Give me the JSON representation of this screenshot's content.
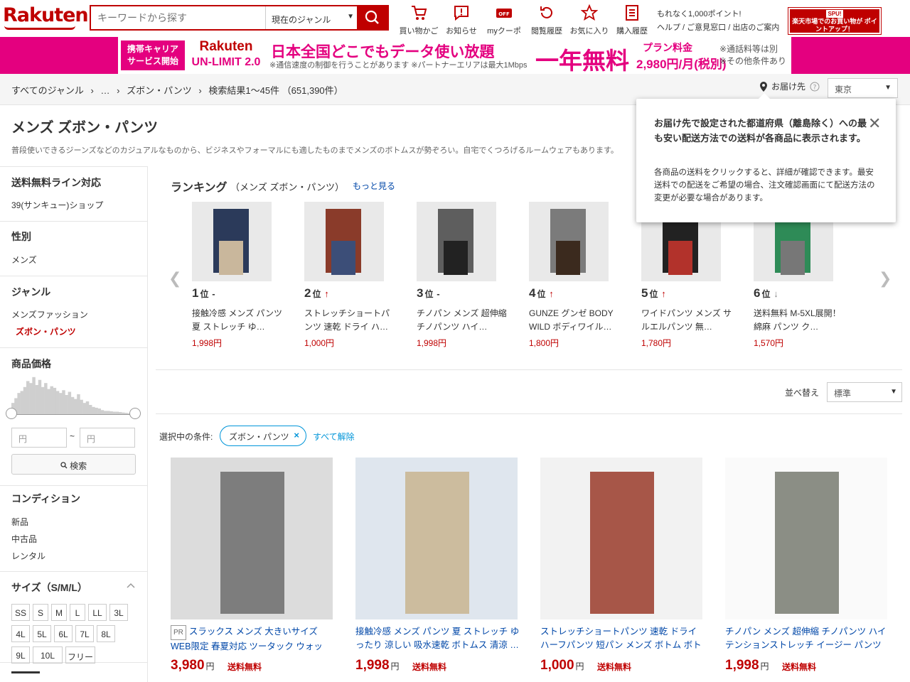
{
  "header": {
    "logo": "Rakuten",
    "search_placeholder": "キーワードから探す",
    "genre_select": "現在のジャンル",
    "icons": [
      {
        "label": "買い物かご",
        "icon": "cart-icon"
      },
      {
        "label": "お知らせ",
        "icon": "notice-icon"
      },
      {
        "label": "myクーポン",
        "icon": "coupon-icon"
      },
      {
        "label": "閲覧履歴",
        "icon": "history-icon"
      },
      {
        "label": "お気に入り",
        "icon": "star-icon"
      },
      {
        "label": "購入履歴",
        "icon": "receipt-icon"
      }
    ],
    "points_text": "もれなく1,000ポイント!",
    "help_links": "ヘルプ / ご意見窓口 / 出店のご案内",
    "spu_top": "SPU!",
    "spu_text": "楽天市場でのお買い物が ポイントアップ！"
  },
  "banner": {
    "tag_line1": "携帯キャリア",
    "tag_line2": "サービス開始",
    "brand": "Rakuten",
    "brand_sub": "UN-LIMIT 2.0",
    "main": "日本全国どこでもデータ使い放題",
    "sub": "※通信速度の制御を行うことがあります ※パートナーエリアは最大1Mbps",
    "free": "一年無料",
    "plan": "プラン料金",
    "price": "2,980円/月(税別)",
    "note1": "※通話料等は別",
    "note2": "※その他条件あり"
  },
  "breadcrumb": {
    "items": [
      "すべてのジャンル",
      "›",
      "…",
      "›",
      "ズボン・パンツ",
      "›"
    ],
    "result": "検索結果1〜45件 （651,390件）",
    "delivery_label": "お届け先",
    "delivery_value": "東京"
  },
  "page": {
    "title": "メンズ ズボン・パンツ",
    "description": "普段使いできるジーンズなどのカジュアルなものから、ビジネスやフォーマルにも適したものまでメンズのボトムスが勢ぞろい。自宅でくつろげるルームウェアもあります。"
  },
  "sidebar": {
    "shipping_title": "送料無料ライン対応",
    "shipping_item": "39(サンキュー)ショップ",
    "gender_title": "性別",
    "gender_item": "メンズ",
    "genre_title": "ジャンル",
    "genre_parent": "メンズファッション",
    "genre_current": "ズボン・パンツ",
    "price_title": "商品価格",
    "price_min_placeholder": "円",
    "price_sep": "~",
    "price_max_placeholder": "円",
    "search_button": "検索",
    "condition_title": "コンディション",
    "conditions": [
      "新品",
      "中古品",
      "レンタル"
    ],
    "size_title": "サイズ（S/M/L）",
    "sizes": [
      "SS",
      "S",
      "M",
      "L",
      "LL",
      "3L",
      "4L",
      "5L",
      "6L",
      "7L",
      "8L",
      "9L",
      "10L",
      "フリー"
    ],
    "histogram": [
      0.3,
      0.42,
      0.55,
      0.6,
      0.7,
      0.85,
      0.8,
      0.95,
      0.75,
      0.88,
      0.7,
      0.8,
      0.65,
      0.72,
      0.68,
      0.6,
      0.55,
      0.62,
      0.5,
      0.58,
      0.45,
      0.4,
      0.52,
      0.38,
      0.3,
      0.34,
      0.25,
      0.2,
      0.18,
      0.16,
      0.12,
      0.1,
      0.1,
      0.09,
      0.08,
      0.08,
      0.07,
      0.06,
      0.05,
      0.04,
      0.04,
      0.03
    ]
  },
  "ranking": {
    "title": "ランキング",
    "subtitle": "（メンズ ズボン・パンツ）",
    "more": "もっと見る",
    "items": [
      {
        "rank": "1",
        "unit": "位",
        "trend": "-",
        "name": "接触冷感 メンズ パンツ 夏 ストレッチ ゆ…",
        "price": "1,998円"
      },
      {
        "rank": "2",
        "unit": "位",
        "trend": "↑",
        "name": "ストレッチショートパンツ 速乾 ドライ ハ…",
        "price": "1,000円"
      },
      {
        "rank": "3",
        "unit": "位",
        "trend": "-",
        "name": "チノパン メンズ 超伸縮 チノパンツ ハイ…",
        "price": "1,998円"
      },
      {
        "rank": "4",
        "unit": "位",
        "trend": "↑",
        "name": "GUNZE グンゼ BODY WILD ボディワイル…",
        "price": "1,800円"
      },
      {
        "rank": "5",
        "unit": "位",
        "trend": "↑",
        "name": "ワイドパンツ メンズ サルエルパンツ 無…",
        "price": "1,780円"
      },
      {
        "rank": "6",
        "unit": "位",
        "trend": "↓",
        "name": "送料無料 M-5XL展開！綿麻 パンツ ク…",
        "price": "1,570円"
      }
    ]
  },
  "sort": {
    "label": "並べ替え",
    "value": "標準"
  },
  "filters": {
    "label": "選択中の条件:",
    "chip": "ズボン・パンツ",
    "clear": "すべて解除"
  },
  "products": [
    {
      "pr": "PR",
      "name": "スラックス メンズ 大きいサイズ WEB限定 春夏対応 ツータック ウォッシ…",
      "price": "3,980",
      "yen": "円",
      "ship": "送料無料"
    },
    {
      "pr": "",
      "name": "接触冷感 メンズ パンツ 夏 ストレッチ ゆったり 涼しい 吸水速乾 ボトムス 清涼 …",
      "price": "1,998",
      "yen": "円",
      "ship": "送料無料"
    },
    {
      "pr": "",
      "name": "ストレッチショートパンツ 速乾 ドライ ハーフパンツ 短パン メンズ ボトム ボトム…",
      "price": "1,000",
      "yen": "円",
      "ship": "送料無料"
    },
    {
      "pr": "",
      "name": "チノパン メンズ 超伸縮 チノパンツ ハイテンションストレッチ イージー パンツ ス…",
      "price": "1,998",
      "yen": "円",
      "ship": "送料無料"
    }
  ],
  "popup": {
    "title": "お届け先で設定された都道府県（離島除く）への最も安い配送方法での送料が各商品に表示されます。",
    "body": "各商品の送料をクリックすると、詳細が確認できます。最安送料での配送をご希望の場合、注文確認画面にて配送方法の変更が必要な場合があります。",
    "close": "✕"
  },
  "colors": {
    "brand": "#bf0000",
    "banner": "#e4007f",
    "link": "#0047a8",
    "chip": "#0095d9"
  }
}
